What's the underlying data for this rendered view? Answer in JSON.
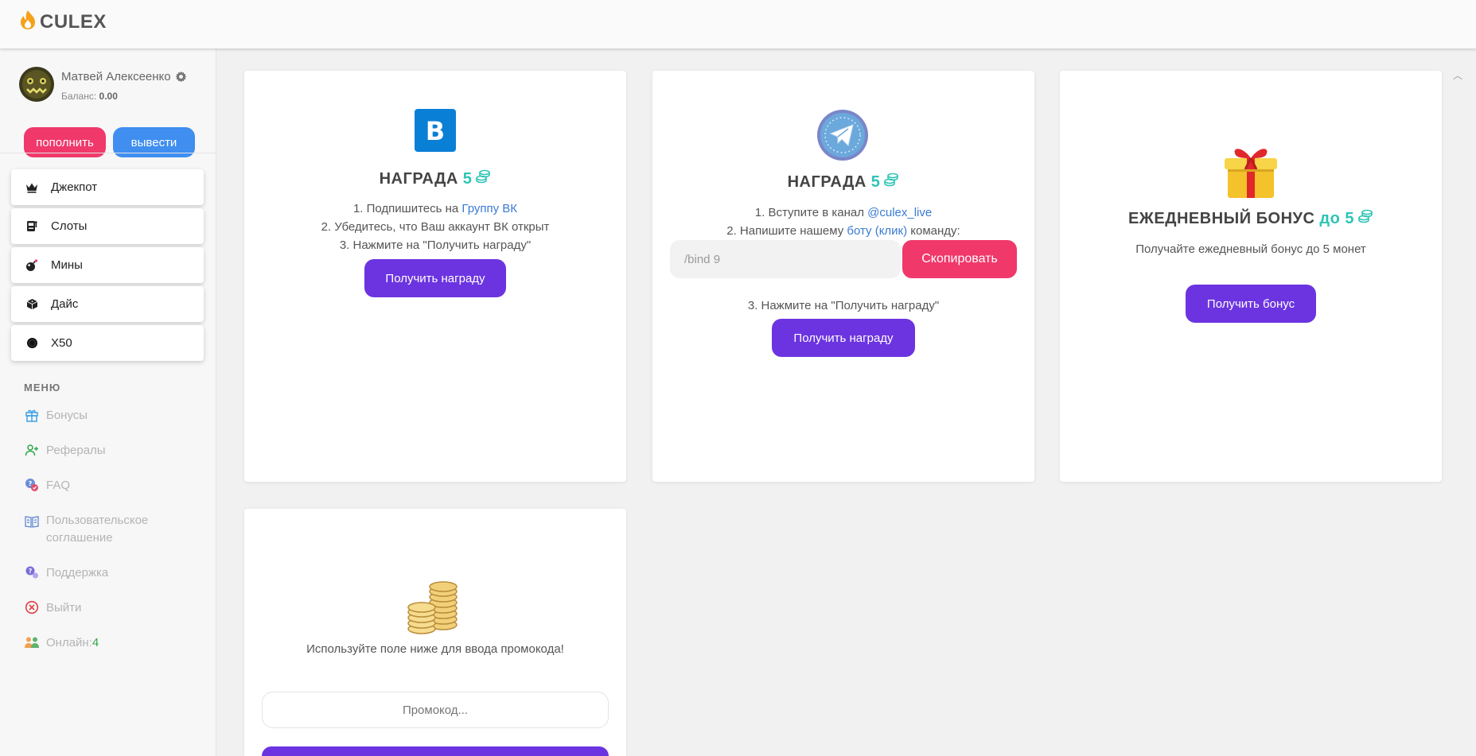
{
  "header": {
    "logo_text": "CULEX"
  },
  "user": {
    "name": "Матвей Алексеенко",
    "balance_label": "Баланс:",
    "balance_value": "0.00",
    "topup_label": "пополнить",
    "withdraw_label": "вывести"
  },
  "games": [
    {
      "label": "Джекпот",
      "icon": "crown-icon"
    },
    {
      "label": "Слоты",
      "icon": "slot-machine-icon"
    },
    {
      "label": "Мины",
      "icon": "bomb-icon"
    },
    {
      "label": "Дайс",
      "icon": "dice-icon"
    },
    {
      "label": "X50",
      "icon": "circle-icon"
    }
  ],
  "menu": {
    "title": "МЕНЮ",
    "items": [
      {
        "label": "Бонусы",
        "icon": "gift-icon"
      },
      {
        "label": "Рефералы",
        "icon": "user-plus-icon"
      },
      {
        "label": "FAQ",
        "icon": "faq-icon"
      },
      {
        "label": "Пользовательское соглашение",
        "icon": "book-icon"
      },
      {
        "label": "Поддержка",
        "icon": "support-icon"
      },
      {
        "label": "Выйти",
        "icon": "exit-icon"
      },
      {
        "label": "Онлайн:",
        "icon": "users-icon"
      }
    ],
    "online_count": "4"
  },
  "vk_card": {
    "title": "НАГРАДА",
    "reward": "5",
    "step1_prefix": "1. Подпишитесь на",
    "step1_link": "Группу ВК",
    "step2": "2. Убедитесь, что Ваш аккаунт ВК открыт",
    "step3": "3. Нажмите на \"Получить награду\"",
    "button": "Получить награду"
  },
  "tg_card": {
    "title": "НАГРАДА",
    "reward": "5",
    "step1_prefix": "1. Вступите в канал",
    "step1_link": "@culex_live",
    "step2_prefix": "2. Напишите нашему",
    "step2_link": "боту (клик)",
    "step2_suffix": "команду:",
    "command": "/bind 9",
    "copy_button": "Скопировать",
    "step3": "3. Нажмите на \"Получить награду\"",
    "button": "Получить награду"
  },
  "daily_card": {
    "title": "ЕЖЕДНЕВНЫЙ БОНУС",
    "reward": "до 5",
    "description": "Получайте ежедневный бонус до 5 монет",
    "button": "Получить бонус"
  },
  "promo_card": {
    "description": "Используйте поле ниже для ввода промокода!",
    "placeholder": "Промокод..."
  },
  "colors": {
    "purple": "#6c34e0",
    "pink": "#f0386b",
    "blue": "#3f8ef0",
    "teal": "#2ec4b6",
    "link": "#3a7bd5"
  }
}
